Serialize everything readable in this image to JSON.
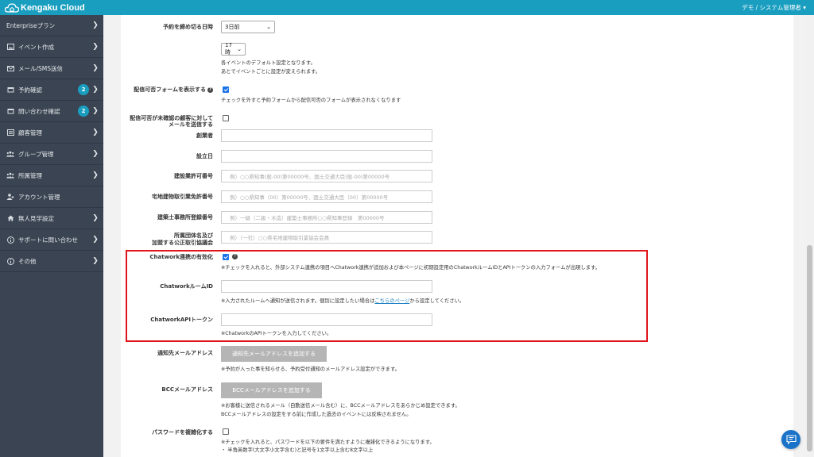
{
  "header": {
    "logo_text": "Kengaku Cloud",
    "user_menu": "デモ / システム管理者"
  },
  "sidebar": {
    "items": [
      {
        "label": "Enterpriseプラン",
        "icon": "none",
        "badge": ""
      },
      {
        "label": "イベント作成",
        "icon": "image-icon",
        "badge": ""
      },
      {
        "label": "メール/SMS送信",
        "icon": "envelope-icon",
        "badge": ""
      },
      {
        "label": "予約確認",
        "icon": "calendar-icon",
        "badge": "2"
      },
      {
        "label": "問い合わせ確認",
        "icon": "calendar-icon",
        "badge": "2"
      },
      {
        "label": "顧客管理",
        "icon": "list-icon",
        "badge": ""
      },
      {
        "label": "グループ管理",
        "icon": "group-icon",
        "badge": ""
      },
      {
        "label": "所属管理",
        "icon": "group-icon",
        "badge": ""
      },
      {
        "label": "アカウント管理",
        "icon": "user-icon",
        "badge": ""
      },
      {
        "label": "無人見学設定",
        "icon": "home-icon",
        "badge": ""
      },
      {
        "label": "サポートに問い合わせ",
        "icon": "info-icon",
        "badge": ""
      },
      {
        "label": "その他",
        "icon": "info-icon",
        "badge": ""
      }
    ]
  },
  "form": {
    "deadline": {
      "label": "予約を締め切る日時",
      "day_value": "3日前",
      "hour_value": "17時",
      "note1": "各イベントのデフォルト設定となります。",
      "note2": "あとでイベントごとに設定が変えられます。"
    },
    "show_unsubscribe": {
      "label": "配信可否フォームを表示する",
      "checked": true,
      "note": "チェックを外すと予約フォームから配信可否のフォームが表示されなくなります"
    },
    "send_unconfirmed": {
      "label1": "配信可否が未確認の顧客に対して",
      "label2": "メールを送信する",
      "checked": false
    },
    "founder": {
      "label": "創業者",
      "value": ""
    },
    "established": {
      "label": "設立日",
      "value": ""
    },
    "construction_license": {
      "label": "建設業許可番号",
      "placeholder": "例）○○県知事(般-00)第00000号、国土交通大臣(般-00)第00000号"
    },
    "realestate_license": {
      "label": "宅地建物取引業免許番号",
      "placeholder": "例）○○県知事（00）第00000号、国土交通大臣（00）第00000号"
    },
    "architect_registration": {
      "label": "建築士事務所登録番号",
      "placeholder": "例）一級（二級・木造）建築士事務所○○県知事登録　第00000号"
    },
    "association": {
      "label1": "所属団体名及び",
      "label2": "加盟する公正取引協議会",
      "placeholder": "例）（一社）○○県宅地建物取引業協会会員"
    },
    "chatwork_enable": {
      "label": "Chatwork連携の有効化",
      "checked": true,
      "note": "※チェックを入れると、外部システム連携の項目へChatwork連携が追加および本ページに初期設定用のChatworkルームIDとAPIトークンの入力フォームが出現します。"
    },
    "chatwork_room": {
      "label": "ChatworkルームID",
      "value": "",
      "note_before": "※入力されたルームへ通知が送信されます。個別に設定したい場合は",
      "note_link": "こちらのページ",
      "note_after": "から設定してください。"
    },
    "chatwork_token": {
      "label": "ChatworkAPIトークン",
      "value": "",
      "note": "※ChatworkのAPIトークンを入力してください。"
    },
    "notify_email": {
      "label": "通知先メールアドレス",
      "button": "通知先メールアドレスを追加する",
      "note": "※予約が入った事を知らせる、予約受付通知のメールアドレス設定ができます。"
    },
    "bcc_email": {
      "label": "BCCメールアドレス",
      "button": "BCCメールアドレスを追加する",
      "note1": "※お客様に送信されるメール（自動送信メール含む）に、BCCメールアドレスをあらかじめ設定できます。",
      "note2": "BCCメールアドレスの設定をする前に作成した過去のイベントには反映されません。"
    },
    "password_complex": {
      "label": "パスワードを複雑化する",
      "checked": false,
      "note1": "※チェックを入れると、パスワードを以下の要件を満たすように複雑化できるようになります。",
      "note2": "・ 半角英数字(大文字小文字含む)と記号を1文字以上含む8文字以上"
    }
  },
  "colors": {
    "accent": "#1a9ec0",
    "sidebar_bg": "#3a4452",
    "highlight": "#e0141b"
  }
}
